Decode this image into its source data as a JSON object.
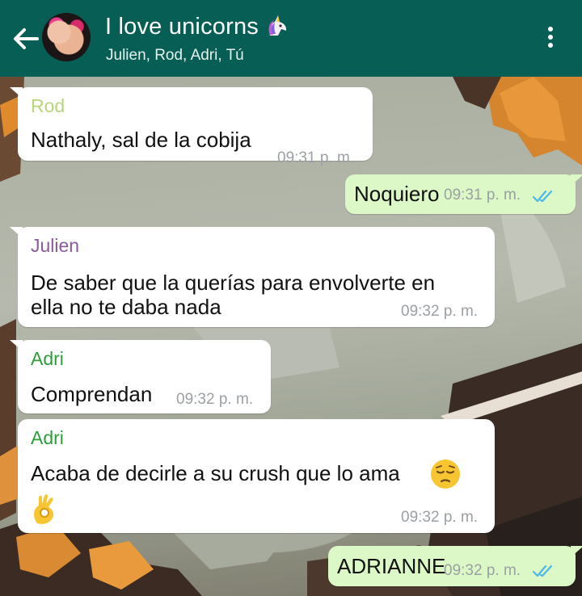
{
  "header": {
    "title": "I love unicorns",
    "title_icon": "unicorn-icon",
    "subtitle": "Julien, Rod, Adri, Tú",
    "back_icon": "back-arrow-icon",
    "menu_icon": "more-options-icon"
  },
  "colors": {
    "header_bg": "#075e54",
    "incoming_bubble": "#ffffff",
    "outgoing_bubble": "#dcf8c6",
    "sender_rod": "#b7d67a",
    "sender_julien": "#8a5a9e",
    "sender_adri": "#2e9e3a",
    "read_ticks": "#4fb6ec",
    "timestamp": "#9aa0a3"
  },
  "messages": [
    {
      "direction": "in",
      "sender": "Rod",
      "text": "Nathaly, sal de la cobija",
      "time": "09:31 p. m."
    },
    {
      "direction": "out",
      "text": "Noquiero",
      "time": "09:31 p. m.",
      "status": "read"
    },
    {
      "direction": "in",
      "sender": "Julien",
      "text_line1": "De saber que la querías para envolverte en",
      "text_line2": "ella no te daba nada",
      "time": "09:32 p. m."
    },
    {
      "direction": "in",
      "sender": "Adri",
      "text": "Comprendan",
      "time": "09:32 p. m."
    },
    {
      "direction": "in",
      "sender": "Adri",
      "text": "Acaba de decirle a su crush que lo ama",
      "emoji_1": "pensive-face-icon",
      "emoji_2": "ok-hand-icon",
      "time": "09:32 p. m."
    },
    {
      "direction": "out",
      "text": "ADRIANNE",
      "time": "09:32 p. m.",
      "status": "read"
    }
  ]
}
